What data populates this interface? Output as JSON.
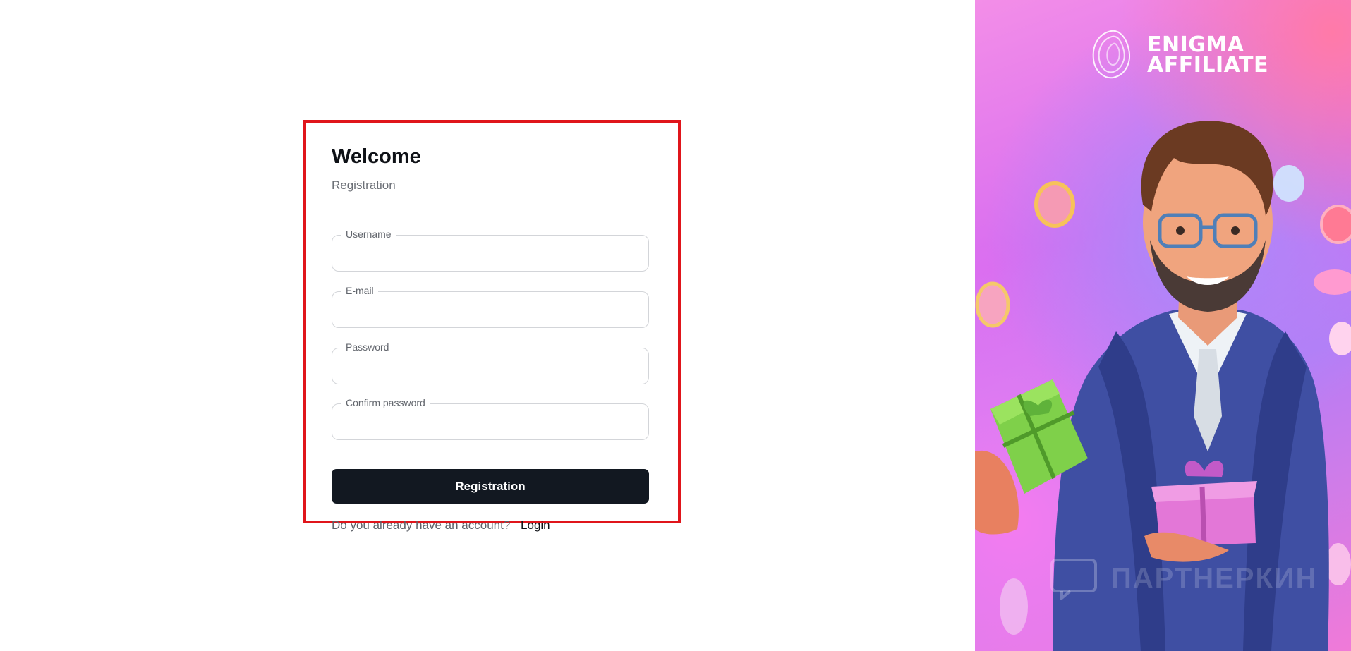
{
  "form": {
    "title": "Welcome",
    "subtitle": "Registration",
    "fields": [
      {
        "label": "Username",
        "value": ""
      },
      {
        "label": "E-mail",
        "value": ""
      },
      {
        "label": "Password",
        "value": ""
      },
      {
        "label": "Confirm password",
        "value": ""
      }
    ],
    "submit_label": "Registration",
    "footer_question": "Do you already have an account?",
    "login_link": "Login"
  },
  "hero": {
    "brand_line1": "ENIGMA",
    "brand_line2": "AFFILIATE",
    "watermark": "ПАРТНЕРКИН"
  },
  "colors": {
    "highlight_border": "#e0151b",
    "button_bg": "#121821",
    "hero_pink": "#f38ee8",
    "hero_violet": "#b57df6"
  }
}
